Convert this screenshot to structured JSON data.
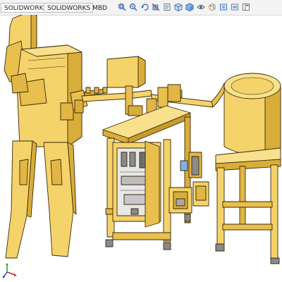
{
  "tabs": [
    {
      "label": "SOLIDWORKS 插件"
    },
    {
      "label": "SOLIDWORKS MBD"
    }
  ],
  "heads_up_toolbar": [
    {
      "icon": "zoom-to-fit-icon"
    },
    {
      "icon": "zoom-to-area-icon"
    },
    {
      "icon": "previous-view-icon"
    },
    {
      "icon": "section-view-icon"
    },
    {
      "icon": "dynamic-annotation-icon"
    },
    {
      "icon": "view-orientation-icon"
    },
    {
      "icon": "display-style-icon"
    },
    {
      "icon": "hide-show-items-icon"
    },
    {
      "icon": "edit-appearance-icon"
    },
    {
      "icon": "apply-scene-icon"
    },
    {
      "icon": "view-settings-icon"
    },
    {
      "icon": "display-pane-icon"
    }
  ],
  "colors": {
    "model_face": "#f5d36b",
    "model_shade": "#d9ad3a",
    "model_dark": "#b98a25",
    "edge": "#3a2a0a",
    "electrical_panel": "#e7e7e7",
    "toolbar_bg": "#f3f3f3",
    "triad_x": "#d82020",
    "triad_y": "#20a020",
    "triad_z": "#2040d0"
  }
}
